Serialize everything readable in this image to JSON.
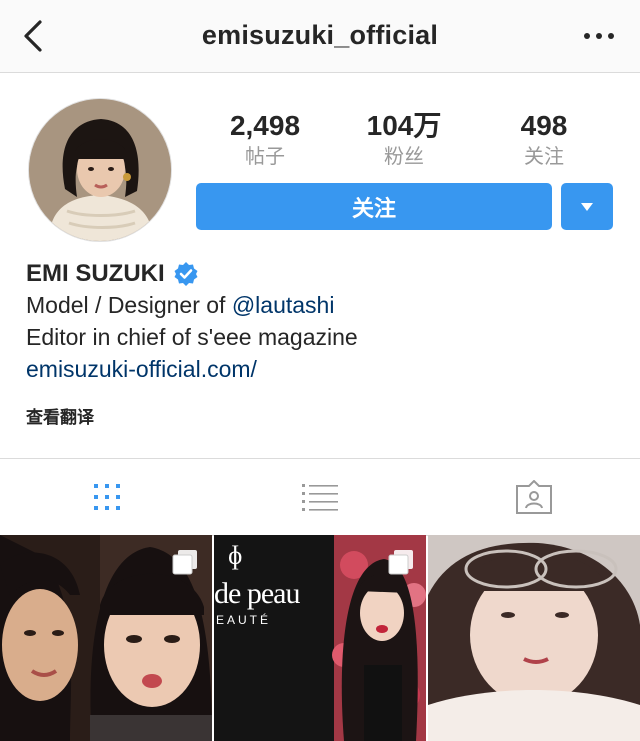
{
  "header": {
    "username": "emisuzuki_official",
    "back_icon": "chevron-left-icon",
    "more_icon": "more-dots-icon"
  },
  "stats": [
    {
      "value": "2,498",
      "label": "帖子"
    },
    {
      "value": "104万",
      "label": "粉丝"
    },
    {
      "value": "498",
      "label": "关注"
    }
  ],
  "actions": {
    "follow_label": "关注",
    "dropdown_icon": "caret-down-icon"
  },
  "profile": {
    "name": "EMI SUZUKI",
    "verified_icon": "verified-badge-icon",
    "bio_prefix": "Model / Designer of ",
    "bio_mention": "@lautashi",
    "bio_line2": "Editor in chief of s'eee magazine",
    "website": "emisuzuki-official.com/",
    "translate_label": "查看翻译"
  },
  "tabs": [
    {
      "icon": "grid-icon",
      "active": true
    },
    {
      "icon": "list-icon",
      "active": false
    },
    {
      "icon": "tagged-icon",
      "active": false
    }
  ],
  "posts": [
    {
      "caption_text": "",
      "multi": true
    },
    {
      "caption_text": "de peau",
      "caption_sub": "EAUTÉ",
      "brand_mark": "ɸ",
      "multi": true
    },
    {
      "caption_text": "",
      "multi": false
    }
  ],
  "colors": {
    "accent": "#3897f0",
    "link": "#003569",
    "muted": "#999999",
    "border": "#dbdbdb"
  }
}
